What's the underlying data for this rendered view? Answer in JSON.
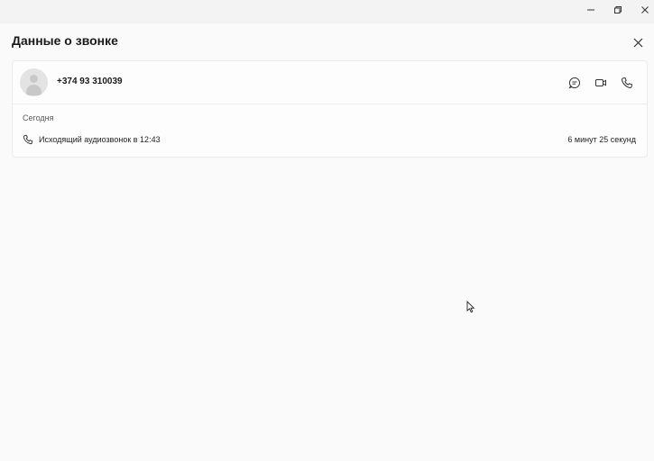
{
  "window": {
    "controls": {
      "minimize_icon": "minimize-icon",
      "restore_icon": "restore-icon",
      "close_icon": "close-icon"
    }
  },
  "header": {
    "title": "Данные о звонке",
    "close_icon": "close-icon"
  },
  "contact": {
    "phone": "+374 93 310039",
    "avatar_icon": "person-icon",
    "actions": [
      {
        "name": "chat",
        "icon": "chat-icon"
      },
      {
        "name": "video",
        "icon": "video-icon"
      },
      {
        "name": "call",
        "icon": "phone-icon"
      }
    ]
  },
  "history": {
    "date_label": "Сегодня",
    "calls": [
      {
        "description": "Исходящий аудиозвонок в 12:43",
        "duration": "6 минут 25 секунд",
        "icon": "phone-icon"
      }
    ]
  },
  "colors": {
    "background": "#fafafa",
    "card_border": "#ececec",
    "text": "#1a1a1a",
    "muted": "#5a5a5a"
  }
}
